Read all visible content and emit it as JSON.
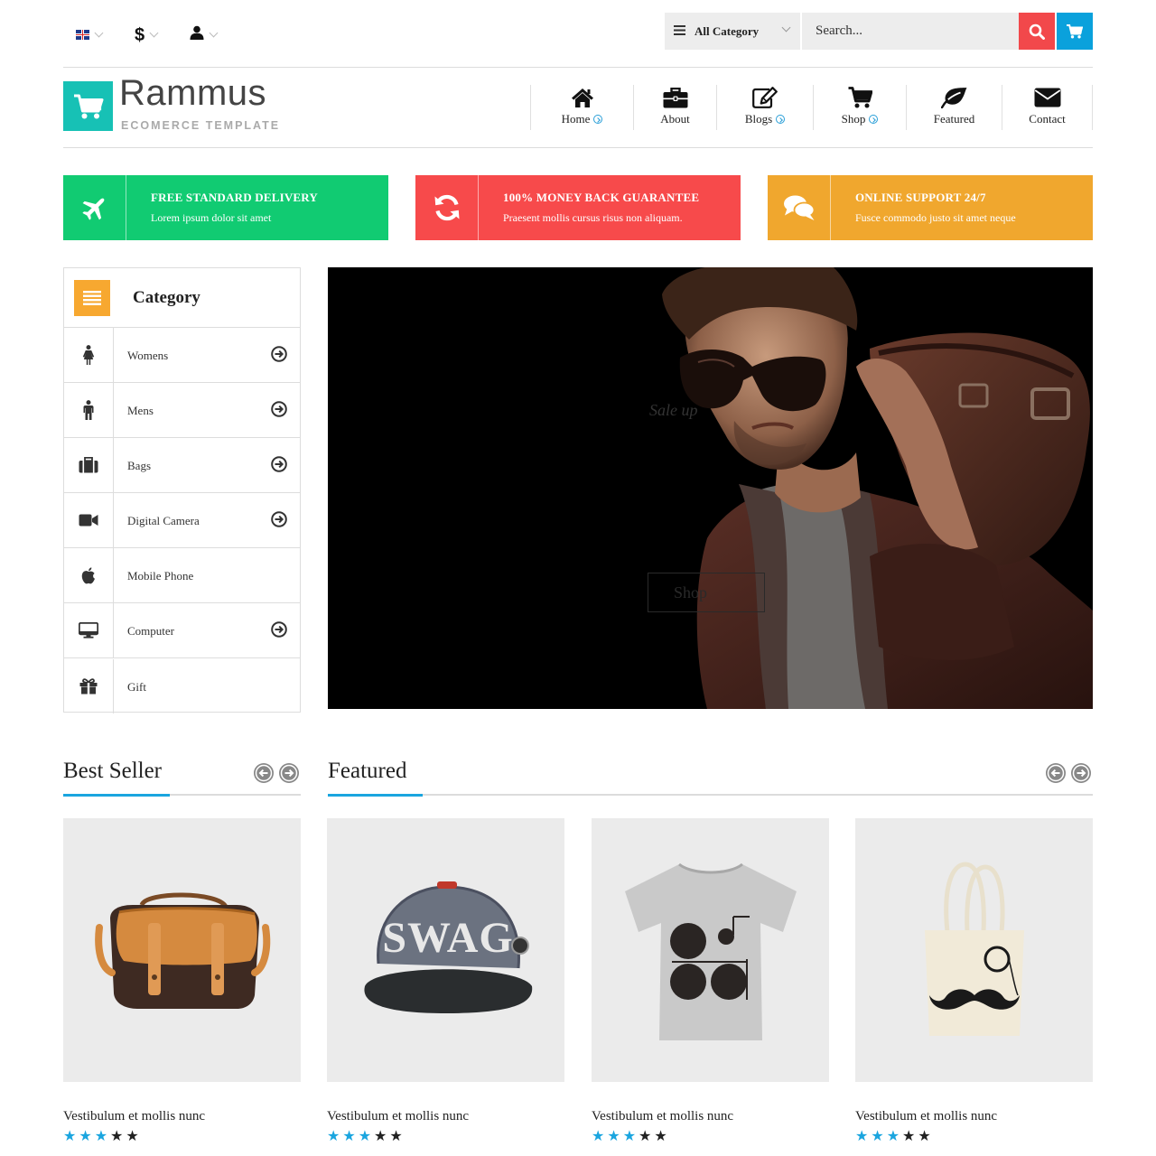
{
  "topbar": {
    "language_icon": "uk-flag-icon",
    "currency": "$",
    "account_icon": "user-icon",
    "category_select": "All Category",
    "search_placeholder": "Search...",
    "search_icon": "search-icon",
    "cart_icon": "cart-icon"
  },
  "logo": {
    "title": "Rammus",
    "subtitle": "ECOMERCE TEMPLATE",
    "icon": "cart-icon"
  },
  "nav": [
    {
      "label": "Home",
      "icon": "home-icon",
      "has_submenu": true
    },
    {
      "label": "About",
      "icon": "briefcase-icon",
      "has_submenu": false
    },
    {
      "label": "Blogs",
      "icon": "edit-icon",
      "has_submenu": true
    },
    {
      "label": "Shop",
      "icon": "cart-icon",
      "has_submenu": true
    },
    {
      "label": "Featured",
      "icon": "leaf-icon",
      "has_submenu": false
    },
    {
      "label": "Contact",
      "icon": "envelope-icon",
      "has_submenu": false
    }
  ],
  "features": [
    {
      "title": "FREE STANDARD DELIVERY",
      "text": "Lorem ipsum dolor sit amet",
      "icon": "plane-icon",
      "color": "#11cb72"
    },
    {
      "title": "100% MONEY BACK GUARANTEE",
      "text": "Praesent mollis cursus risus non aliquam.",
      "icon": "refresh-icon",
      "color": "#f74a4b"
    },
    {
      "title": "ONLINE SUPPORT 24/7",
      "text": "Fusce commodo justo sit amet neque",
      "icon": "comments-icon",
      "color": "#f0a72e"
    }
  ],
  "category": {
    "title": "Category",
    "icon": "list-icon",
    "items": [
      {
        "label": "Womens",
        "icon": "female-icon",
        "has_arrow": true
      },
      {
        "label": "Mens",
        "icon": "male-icon",
        "has_arrow": true
      },
      {
        "label": "Bags",
        "icon": "suitcase-icon",
        "has_arrow": true
      },
      {
        "label": "Digital Camera",
        "icon": "video-camera-icon",
        "has_arrow": true
      },
      {
        "label": "Mobile Phone",
        "icon": "apple-icon",
        "has_arrow": false
      },
      {
        "label": "Computer",
        "icon": "desktop-icon",
        "has_arrow": true
      },
      {
        "label": "Gift",
        "icon": "gift-icon",
        "has_arrow": false
      }
    ]
  },
  "hero": {
    "sale_text": "Sale up",
    "button_label": "Shop"
  },
  "sections": {
    "best_seller": "Best Seller",
    "featured": "Featured"
  },
  "products": [
    {
      "name": "Vestibulum et mollis nunc",
      "rating": 3,
      "max_rating": 5,
      "image": "leather-bag"
    },
    {
      "name": "Vestibulum et mollis nunc",
      "rating": 3,
      "max_rating": 5,
      "image": "swag-cap"
    },
    {
      "name": "Vestibulum et mollis nunc",
      "rating": 3,
      "max_rating": 5,
      "image": "grey-tshirt"
    },
    {
      "name": "Vestibulum et mollis nunc",
      "rating": 3,
      "max_rating": 5,
      "image": "tote-bag"
    }
  ],
  "colors": {
    "accent_blue": "#1aa5df",
    "search_red": "#f2484b",
    "cart_blue": "#0aa1dc",
    "logo_teal": "#17c1b5",
    "category_orange": "#f7a830"
  }
}
